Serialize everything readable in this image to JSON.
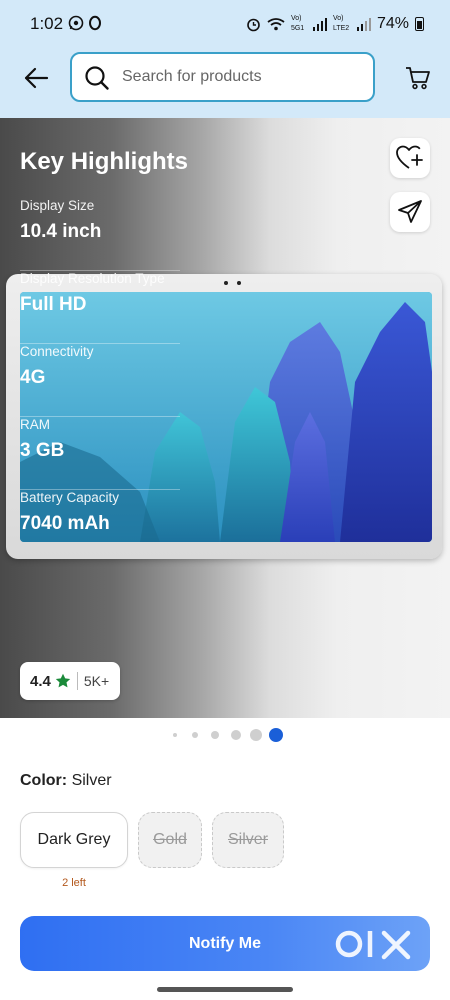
{
  "status_bar": {
    "time": "1:02",
    "battery": "74%",
    "network_1": "Vo) 5G1",
    "network_2": "Vo) LTE2"
  },
  "header": {
    "search_placeholder": "Search for products"
  },
  "highlights": {
    "title": "Key Highlights",
    "items": [
      {
        "label": "Display Size",
        "value": "10.4 inch"
      },
      {
        "label": "Display Resolution Type",
        "value": "Full HD"
      },
      {
        "label": "Connectivity",
        "value": "4G"
      },
      {
        "label": "RAM",
        "value": "3 GB"
      },
      {
        "label": "Battery Capacity",
        "value": "7040 mAh"
      }
    ]
  },
  "rating": {
    "value": "4.4",
    "count": "5K+"
  },
  "carousel": {
    "total_pages": 6,
    "active_page": 6
  },
  "color_selector": {
    "label": "Color:",
    "selected": "Silver",
    "options": [
      {
        "name": "Dark Grey",
        "state": "available",
        "stock_note": "2 left"
      },
      {
        "name": "Gold",
        "state": "unavailable"
      },
      {
        "name": "Silver",
        "state": "unavailable"
      }
    ]
  },
  "cta": {
    "label": "Notify Me"
  },
  "watermark": "OLX",
  "colors": {
    "header_bg": "#d3e9f9",
    "search_border": "#3aa0c9",
    "cta_blue": "#2f6ff2",
    "active_dot": "#1a5fd8",
    "rating_star": "#1b8a3a",
    "stock_note": "#b3581c"
  }
}
